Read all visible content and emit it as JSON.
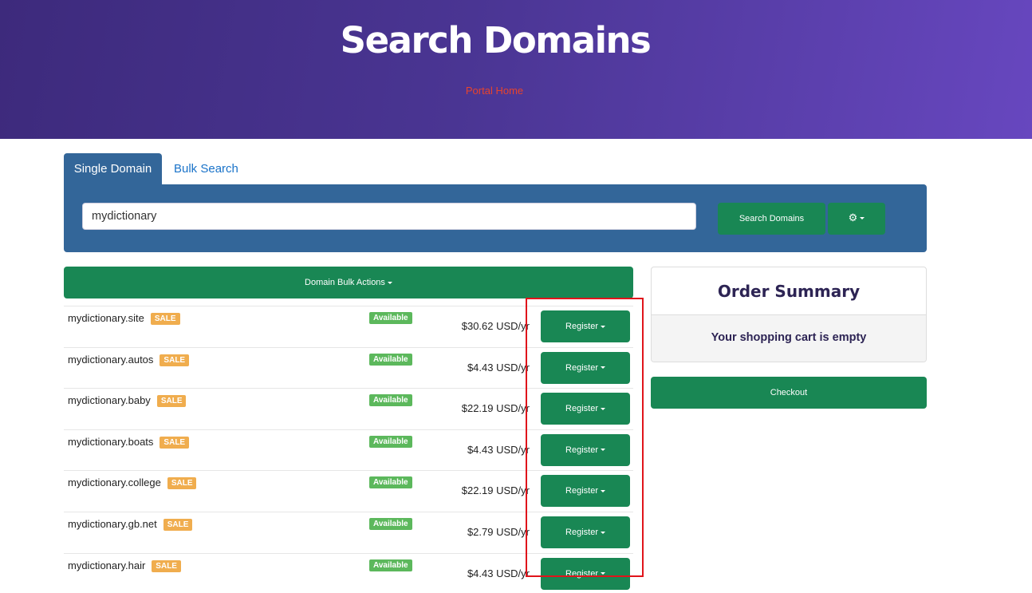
{
  "hero": {
    "title": "Search Domains",
    "link": "Portal Home"
  },
  "tabs": {
    "single": "Single Domain",
    "bulk": "Bulk Search"
  },
  "search": {
    "value": "mydictionary",
    "button": "Search Domains",
    "gear_icon": "gear-icon"
  },
  "bulk_actions": {
    "label": "Domain Bulk Actions"
  },
  "results": [
    {
      "domain": "mydictionary.site",
      "badge": "SALE",
      "status": "Available",
      "price": "$30.62 USD/yr",
      "action": "Register"
    },
    {
      "domain": "mydictionary.autos",
      "badge": "SALE",
      "status": "Available",
      "price": "$4.43 USD/yr",
      "action": "Register"
    },
    {
      "domain": "mydictionary.baby",
      "badge": "SALE",
      "status": "Available",
      "price": "$22.19 USD/yr",
      "action": "Register"
    },
    {
      "domain": "mydictionary.boats",
      "badge": "SALE",
      "status": "Available",
      "price": "$4.43 USD/yr",
      "action": "Register"
    },
    {
      "domain": "mydictionary.college",
      "badge": "SALE",
      "status": "Available",
      "price": "$22.19 USD/yr",
      "action": "Register"
    },
    {
      "domain": "mydictionary.gb.net",
      "badge": "SALE",
      "status": "Available",
      "price": "$2.79 USD/yr",
      "action": "Register"
    },
    {
      "domain": "mydictionary.hair",
      "badge": "SALE",
      "status": "Available",
      "price": "$4.43 USD/yr",
      "action": "Register"
    }
  ],
  "order_summary": {
    "title": "Order Summary",
    "empty_text": "Your shopping cart is empty",
    "checkout": "Checkout"
  },
  "colors": {
    "hero_start": "#3d2a7c",
    "hero_end": "#6747bf",
    "primary_green": "#198754",
    "panel_blue": "#336699",
    "sale": "#f0ad4e",
    "available": "#5cb85c",
    "highlight": "#e0141b"
  }
}
